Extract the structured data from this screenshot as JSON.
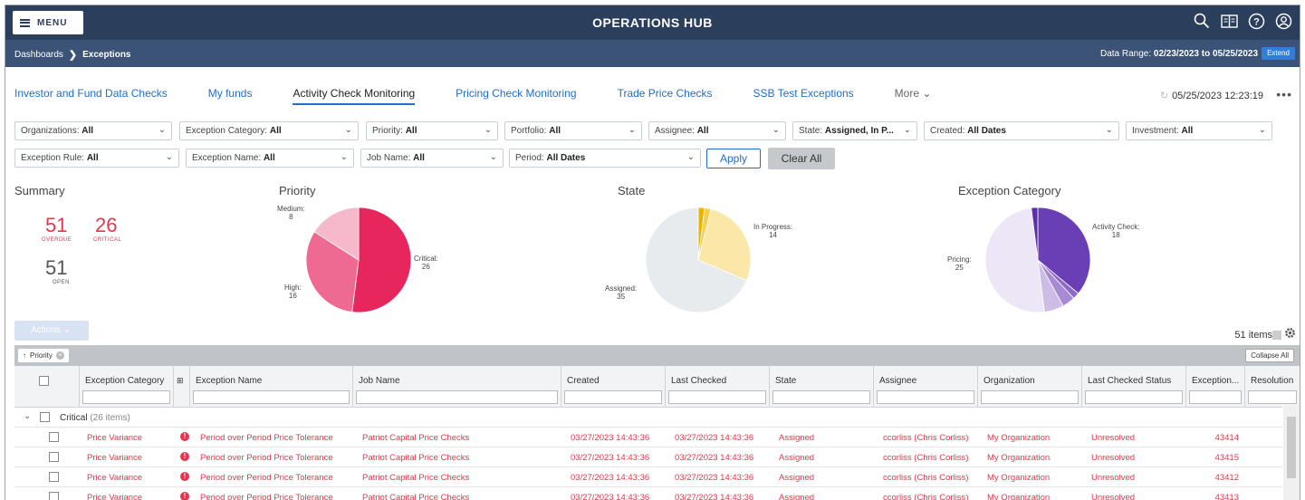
{
  "header": {
    "menu_label": "MENU",
    "title": "OPERATIONS HUB",
    "icons": [
      "search-icon",
      "book-icon",
      "help-icon",
      "user-icon"
    ]
  },
  "breadcrumb": {
    "items": [
      "Dashboards",
      "Exceptions"
    ],
    "date_range_label": "Data Range:",
    "date_range_value": "02/23/2023 to 05/25/2023",
    "extend_label": "Extend"
  },
  "tabs": {
    "items": [
      "Investor and Fund Data Checks",
      "My funds",
      "Activity Check Monitoring",
      "Pricing Check Monitoring",
      "Trade Price Checks",
      "SSB Test Exceptions",
      "More"
    ],
    "active": "Activity Check Monitoring",
    "timestamp": "05/25/2023 12:23:19"
  },
  "filters": {
    "organizations": {
      "label": "Organizations:",
      "value": "All"
    },
    "exception_category": {
      "label": "Exception Category:",
      "value": "All"
    },
    "priority": {
      "label": "Priority:",
      "value": "All"
    },
    "portfolio": {
      "label": "Portfolio:",
      "value": "All"
    },
    "assignee": {
      "label": "Assignee:",
      "value": "All"
    },
    "state": {
      "label": "State:",
      "value": "Assigned, In P..."
    },
    "created": {
      "label": "Created:",
      "value": "All Dates"
    },
    "investment": {
      "label": "Investment:",
      "value": "All"
    },
    "exception_rule": {
      "label": "Exception Rule:",
      "value": "All"
    },
    "exception_name": {
      "label": "Exception Name:",
      "value": "All"
    },
    "job_name": {
      "label": "Job Name:",
      "value": "All"
    },
    "period": {
      "label": "Period:",
      "value": "All Dates"
    },
    "apply_label": "Apply",
    "clear_label": "Clear All"
  },
  "summary": {
    "title": "Summary",
    "overdue": {
      "value": "51",
      "label": "OVERDUE"
    },
    "critical": {
      "value": "26",
      "label": "CRITICAL"
    },
    "open": {
      "value": "51",
      "label": "OPEN"
    }
  },
  "chart_data": [
    {
      "type": "pie",
      "title": "Priority",
      "slices": [
        {
          "name": "Critical",
          "value": 26,
          "color": "#e8265e"
        },
        {
          "name": "High",
          "value": 16,
          "color": "#ef6a92"
        },
        {
          "name": "Medium",
          "value": 8,
          "color": "#f6b9cc"
        }
      ]
    },
    {
      "type": "pie",
      "title": "State",
      "slices": [
        {
          "name": "",
          "value": 1,
          "color": "#e8b400"
        },
        {
          "name": "",
          "value": 1,
          "color": "#f3cf4a"
        },
        {
          "name": "In Progress",
          "value": 14,
          "color": "#fbe7a8"
        },
        {
          "name": "Assigned",
          "value": 35,
          "color": "#e8ebed"
        }
      ]
    },
    {
      "type": "pie",
      "title": "Exception Category",
      "slices": [
        {
          "name": "Activity Check",
          "value": 18,
          "color": "#6a3fb5"
        },
        {
          "name": "",
          "value": 1,
          "color": "#8e6ac8"
        },
        {
          "name": "",
          "value": 2,
          "color": "#a68ad3"
        },
        {
          "name": "",
          "value": 3,
          "color": "#cdbde6"
        },
        {
          "name": "Pricing",
          "value": 25,
          "color": "#ece6f6"
        },
        {
          "name": "",
          "value": 1,
          "color": "#5b2fa6"
        }
      ]
    }
  ],
  "grid": {
    "actions_label": "Actions",
    "items_count": "51 items",
    "sort_chip": "Priority",
    "collapse_all_label": "Collapse All",
    "columns": [
      "Exception Category",
      "Exception Name",
      "Job Name",
      "Created",
      "Last Checked",
      "State",
      "Assignee",
      "Organization",
      "Last Checked Status",
      "Exception...",
      "Resolution"
    ],
    "group_label": "Critical",
    "group_count": "(26 items)",
    "rows": [
      {
        "category": "Price Variance",
        "name": "Period over Period Price Tolerance",
        "job": "Patriot Capital Price Checks",
        "created": "03/27/2023 14:43:36",
        "last_checked": "03/27/2023 14:43:36",
        "state": "Assigned",
        "assignee": "ccorliss (Chris Corliss)",
        "org": "My Organization",
        "status": "Unresolved",
        "exception_id": "43414"
      },
      {
        "category": "Price Variance",
        "name": "Period over Period Price Tolerance",
        "job": "Patriot Capital Price Checks",
        "created": "03/27/2023 14:43:36",
        "last_checked": "03/27/2023 14:43:36",
        "state": "Assigned",
        "assignee": "ccorliss (Chris Corliss)",
        "org": "My Organization",
        "status": "Unresolved",
        "exception_id": "43415"
      },
      {
        "category": "Price Variance",
        "name": "Period over Period Price Tolerance",
        "job": "Patriot Capital Price Checks",
        "created": "03/27/2023 14:43:36",
        "last_checked": "03/27/2023 14:43:36",
        "state": "Assigned",
        "assignee": "ccorliss (Chris Corliss)",
        "org": "My Organization",
        "status": "Unresolved",
        "exception_id": "43412"
      },
      {
        "category": "Price Variance",
        "name": "Period over Period Price Tolerance",
        "job": "Patriot Capital Price Checks",
        "created": "03/27/2023 14:43:36",
        "last_checked": "03/27/2023 14:43:36",
        "state": "Assigned",
        "assignee": "ccorliss (Chris Corliss)",
        "org": "My Organization",
        "status": "Unresolved",
        "exception_id": "43413"
      }
    ]
  }
}
